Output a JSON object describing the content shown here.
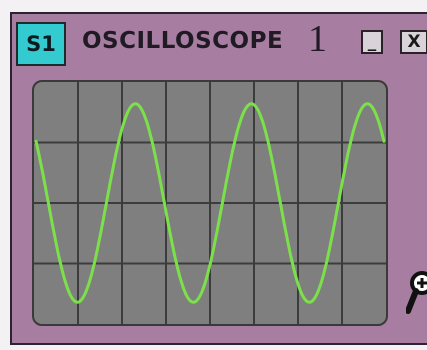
{
  "window": {
    "badge": "S1",
    "title": "OSCILLOSCOPE",
    "channel_number": "1",
    "minimize_label": "_",
    "close_label": "X"
  },
  "display": {
    "grid_columns": 8,
    "grid_rows": 4,
    "trace_color": "#7be04a",
    "grid_color": "#3c3c3c",
    "background_color": "#7f7f7f",
    "waveform": "sine",
    "cycles_visible": 3
  },
  "colors": {
    "window_bg": "#a77da1",
    "badge_bg": "#33cad0"
  },
  "icons": {
    "zoom": "magnifier-plus-icon"
  }
}
